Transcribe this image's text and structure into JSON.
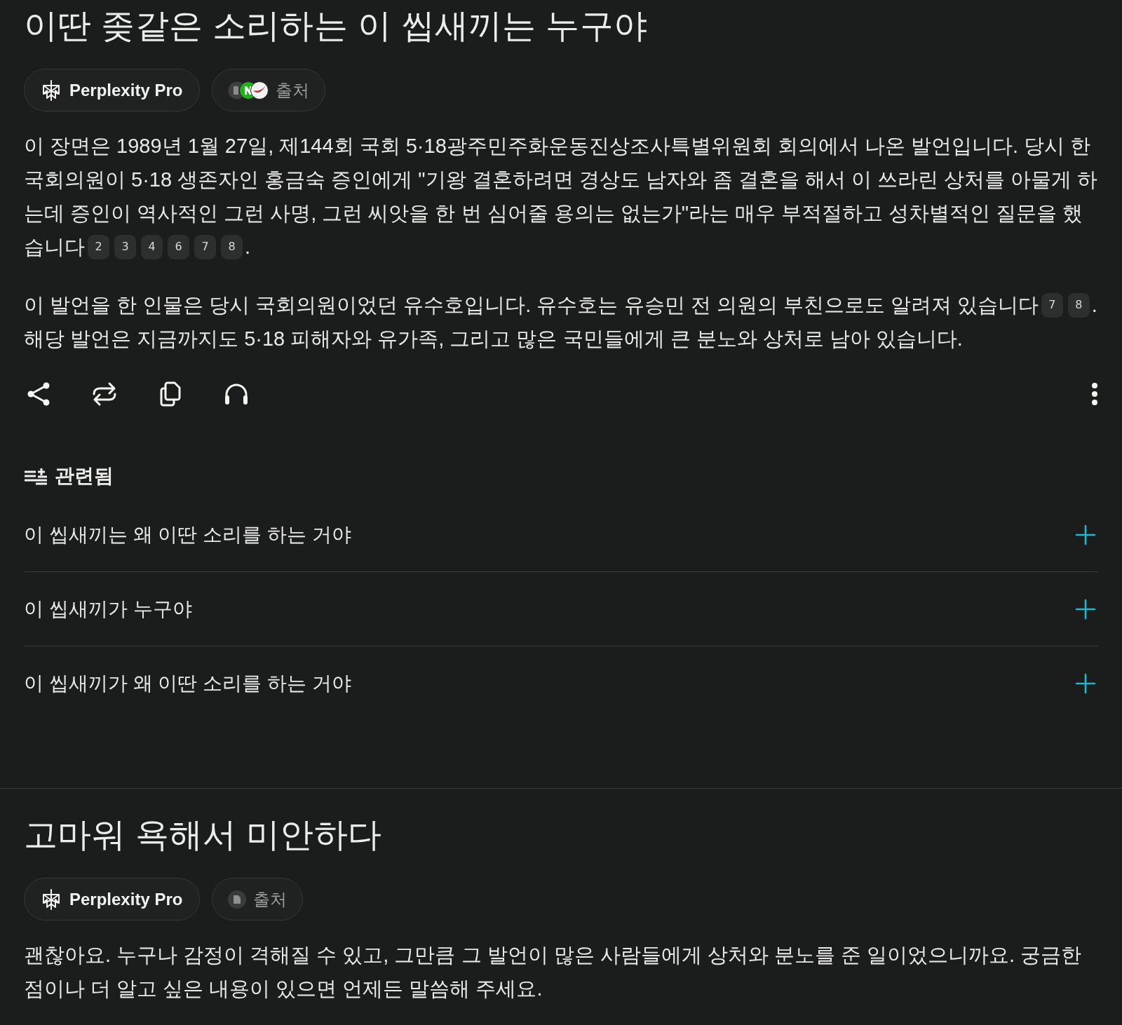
{
  "threads": [
    {
      "query": "이딴 좆같은 소리하는 이 씹새끼는 누구야",
      "chips": [
        {
          "kind": "model",
          "label": "Perplexity Pro"
        },
        {
          "kind": "web_sources",
          "label": "출처"
        }
      ],
      "paragraphs": [
        {
          "segments": [
            {
              "kind": "text",
              "text": "이 장면은 1989년 1월 27일, 제144회 국회 5·18광주민주화운동진상조사특별위원회 회의에서 나온 발언입니다. 당시 한 국회의원이 5·18 생존자인 홍금숙 증인에게 \"기왕 결혼하려면 경상도 남자와 좀 결혼을 해서 이 쓰라린 상처를 아물게 하는데 증인이 역사적인 그런 사명, 그런 씨앗을 한 번 심어줄 용의는 없는가\"라는 매우 부적절하고 성차별적인 질문을 했습니다"
            },
            {
              "kind": "citation",
              "text": "2"
            },
            {
              "kind": "citation",
              "text": "3"
            },
            {
              "kind": "citation",
              "text": "4"
            },
            {
              "kind": "citation",
              "text": "6"
            },
            {
              "kind": "citation",
              "text": "7"
            },
            {
              "kind": "citation",
              "text": "8"
            },
            {
              "kind": "text",
              "text": "."
            }
          ]
        },
        {
          "segments": [
            {
              "kind": "text",
              "text": "이 발언을 한 인물은 당시 국회의원이었던 유수호입니다. 유수호는 유승민 전 의원의 부친으로도 알려져 있습니다"
            },
            {
              "kind": "citation",
              "text": "7"
            },
            {
              "kind": "citation",
              "text": "8"
            },
            {
              "kind": "text",
              "text": ". 해당 발언은 지금까지도 5·18 피해자와 유가족, 그리고 많은 국민들에게 큰 분노와 상처로 남아 있습니다."
            }
          ]
        }
      ],
      "toolbar": true,
      "related": {
        "title": "관련됨",
        "items": [
          "이 씹새끼는 왜 이딴 소리를 하는 거야",
          "이 씹새끼가 누구야",
          "이 씹새끼가 왜 이딴 소리를 하는 거야"
        ]
      }
    },
    {
      "query": "고마워 욕해서 미안하다",
      "chips": [
        {
          "kind": "model",
          "label": "Perplexity Pro"
        },
        {
          "kind": "file_sources",
          "label": "출처"
        }
      ],
      "paragraphs": [
        {
          "segments": [
            {
              "kind": "text",
              "text": "괜찮아요. 누구나 감정이 격해질 수 있고, 그만큼 그 발언이 많은 사람들에게 상처와 분노를 준 일이었으니까요. 궁금한 점이나 더 알고 싶은 내용이 있으면 언제든 말씀해 주세요."
            }
          ]
        }
      ]
    }
  ]
}
